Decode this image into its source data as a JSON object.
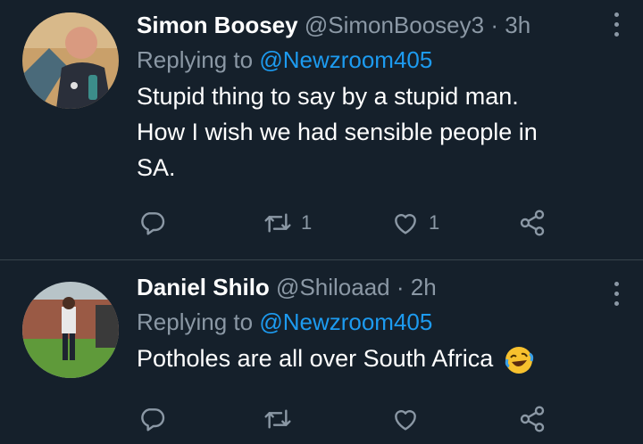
{
  "tweets": [
    {
      "name": "Simon Boosey",
      "handle": "@SimonBoosey3",
      "separator": "·",
      "time": "3h",
      "replying_prefix": "Replying to",
      "replying_to": "@Newzroom405",
      "text_lines": [
        "Stupid thing to say by a stupid man.",
        "How I wish we had sensible people in",
        "SA."
      ],
      "retweet_count": "1",
      "like_count": "1"
    },
    {
      "name": "Daniel Shilo",
      "handle": "@Shiloaad",
      "separator": "·",
      "time": "2h",
      "replying_prefix": "Replying to",
      "replying_to": "@Newzroom405",
      "text": "Potholes are all over South Africa",
      "retweet_count": "",
      "like_count": ""
    }
  ],
  "colors": {
    "background": "#15202b",
    "secondary_text": "#8b98a5",
    "link": "#1d9bf0",
    "divider": "#38444d"
  },
  "icons": [
    "reply-icon",
    "retweet-icon",
    "like-icon",
    "share-icon",
    "more-icon",
    "laughing-emoji-icon"
  ]
}
